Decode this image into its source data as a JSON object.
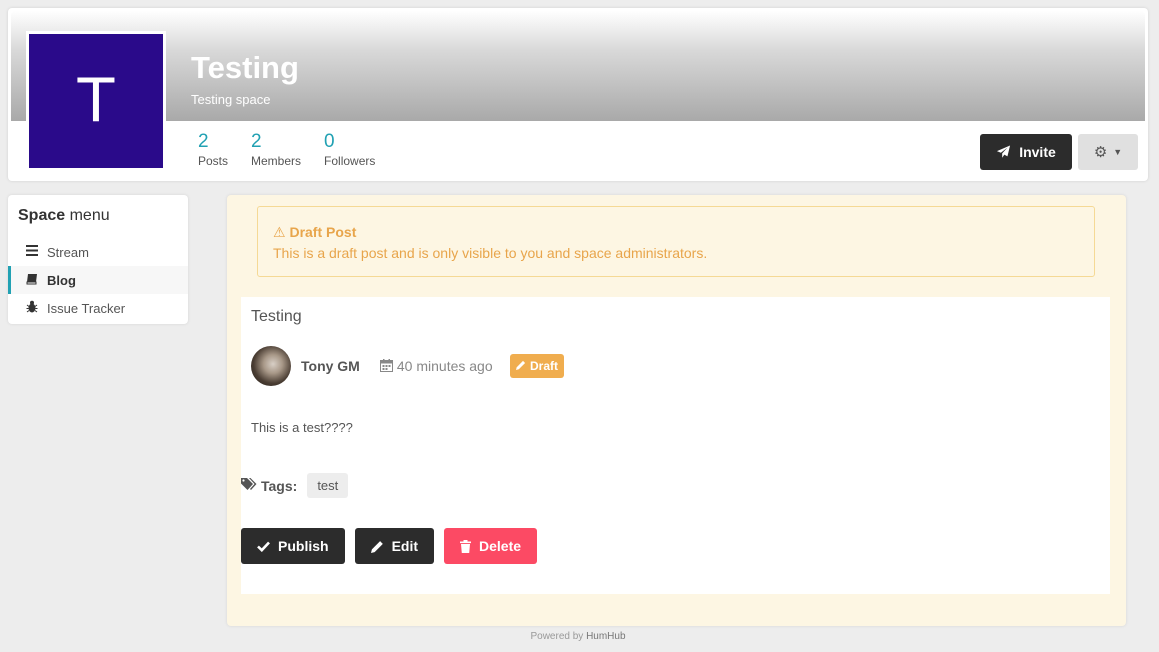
{
  "space": {
    "logo_letter": "T",
    "title": "Testing",
    "description": "Testing space",
    "logo_color": "#2a0a8a",
    "stats": [
      {
        "value": "2",
        "label": "Posts"
      },
      {
        "value": "2",
        "label": "Members"
      },
      {
        "value": "0",
        "label": "Followers"
      }
    ],
    "invite_label": "Invite"
  },
  "sidebar": {
    "heading_bold": "Space",
    "heading_rest": "menu",
    "items": [
      {
        "label": "Stream",
        "icon": "bars-icon",
        "active": false
      },
      {
        "label": "Blog",
        "icon": "book-icon",
        "active": true
      },
      {
        "label": "Issue Tracker",
        "icon": "bug-icon",
        "active": false
      }
    ]
  },
  "alert": {
    "title": "Draft Post",
    "text": "This is a draft post and is only visible to you and space administrators."
  },
  "post": {
    "title": "Testing",
    "author": "Tony GM",
    "time": "40 minutes ago",
    "badge": "Draft",
    "body": "This is a test????",
    "tags_label": "Tags:",
    "tags": [
      "test"
    ],
    "actions": {
      "publish": "Publish",
      "edit": "Edit",
      "delete": "Delete"
    }
  },
  "footer": {
    "prefix": "Powered by",
    "brand": "HumHub"
  },
  "colors": {
    "accent": "#21a1b3",
    "warning": "#f0ad4e",
    "danger": "#fc4a64",
    "dark_button": "#2c2c2c"
  }
}
